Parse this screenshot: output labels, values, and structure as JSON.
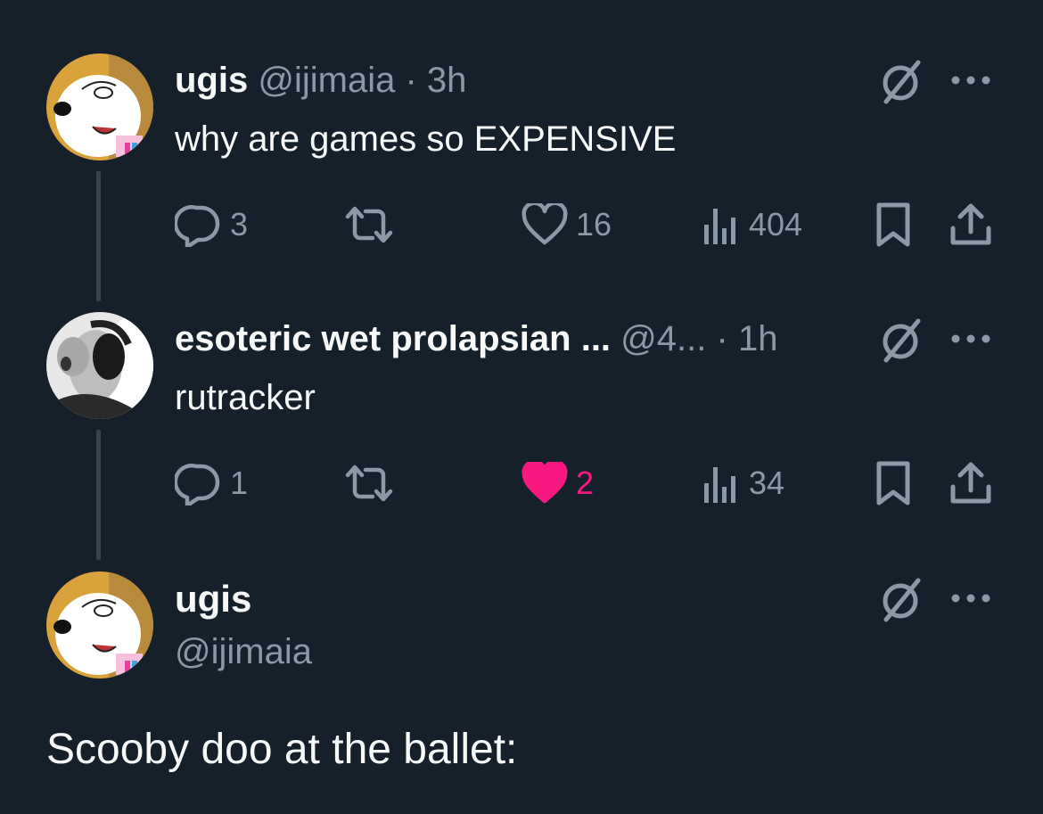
{
  "thread": [
    {
      "display_name": "ugis",
      "handle": "@ijimaia",
      "separator": "·",
      "time": "3h",
      "text": "why are games so EXPENSIVE",
      "stats": {
        "replies": "3",
        "reposts": "",
        "likes": "16",
        "views": "404"
      },
      "liked": false
    },
    {
      "display_name": "esoteric wet prolapsian ...",
      "handle": "@4...",
      "separator": "·",
      "time": "1h",
      "text": "rutracker",
      "stats": {
        "replies": "1",
        "reposts": "",
        "likes": "2",
        "views": "34"
      },
      "liked": true
    }
  ],
  "main_tweet": {
    "display_name": "ugis",
    "handle": "@ijimaia",
    "text": "Scooby doo at the ballet:"
  },
  "colors": {
    "background": "#15202b",
    "text_primary": "#f7f9f9",
    "text_secondary": "#8b98a5",
    "like_active": "#f91880",
    "thread_line": "#38444d"
  },
  "icons": {
    "reply": "reply-icon",
    "repost": "repost-icon",
    "like": "heart-icon",
    "views": "views-icon",
    "bookmark": "bookmark-icon",
    "share": "share-icon",
    "grok": "grok-icon",
    "more": "more-icon"
  }
}
